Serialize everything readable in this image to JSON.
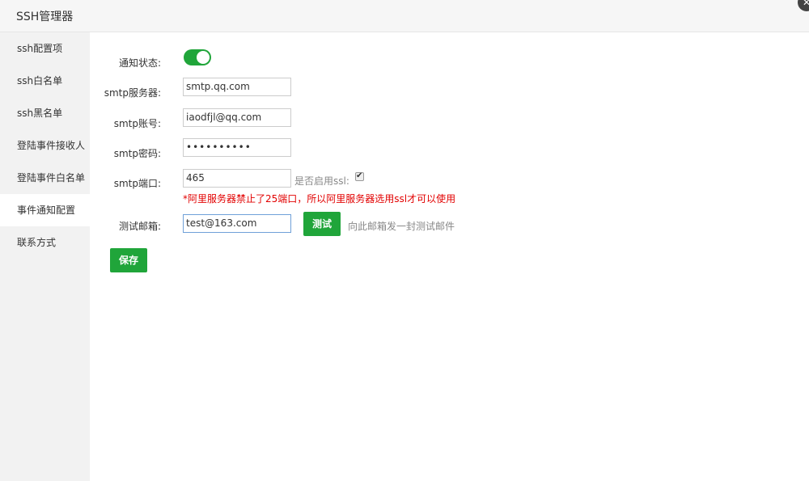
{
  "window": {
    "title": "SSH管理器",
    "close_glyph": "✕"
  },
  "sidebar": {
    "items": [
      {
        "label": "ssh配置项"
      },
      {
        "label": "ssh白名单"
      },
      {
        "label": "ssh黑名单"
      },
      {
        "label": "登陆事件接收人"
      },
      {
        "label": "登陆事件白名单"
      },
      {
        "label": "事件通知配置"
      },
      {
        "label": "联系方式"
      }
    ],
    "active_index": 5
  },
  "form": {
    "notify_status_label": "通知状态:",
    "notify_enabled": true,
    "smtp_server_label": "smtp服务器:",
    "smtp_server_value": "smtp.qq.com",
    "smtp_account_label": "smtp账号:",
    "smtp_account_value": "iaodfjl@qq.com",
    "smtp_password_label": "smtp密码:",
    "smtp_password_value": "••••••••••",
    "smtp_port_label": "smtp端口:",
    "smtp_port_value": "465",
    "ssl_label": "是否启用ssl:",
    "ssl_checked": true,
    "ssl_check_glyph": "✔",
    "warning_text": "*阿里服务器禁止了25端口，所以阿里服务器选用ssl才可以使用",
    "test_email_label": "测试邮箱:",
    "test_email_value": "test@163.com",
    "test_button_label": "测试",
    "test_hint": "向此邮箱发一封测试邮件",
    "save_button_label": "保存"
  },
  "colors": {
    "accent": "#20a53a",
    "warning": "#e20000",
    "sidebar_bg": "#f2f2f2"
  }
}
